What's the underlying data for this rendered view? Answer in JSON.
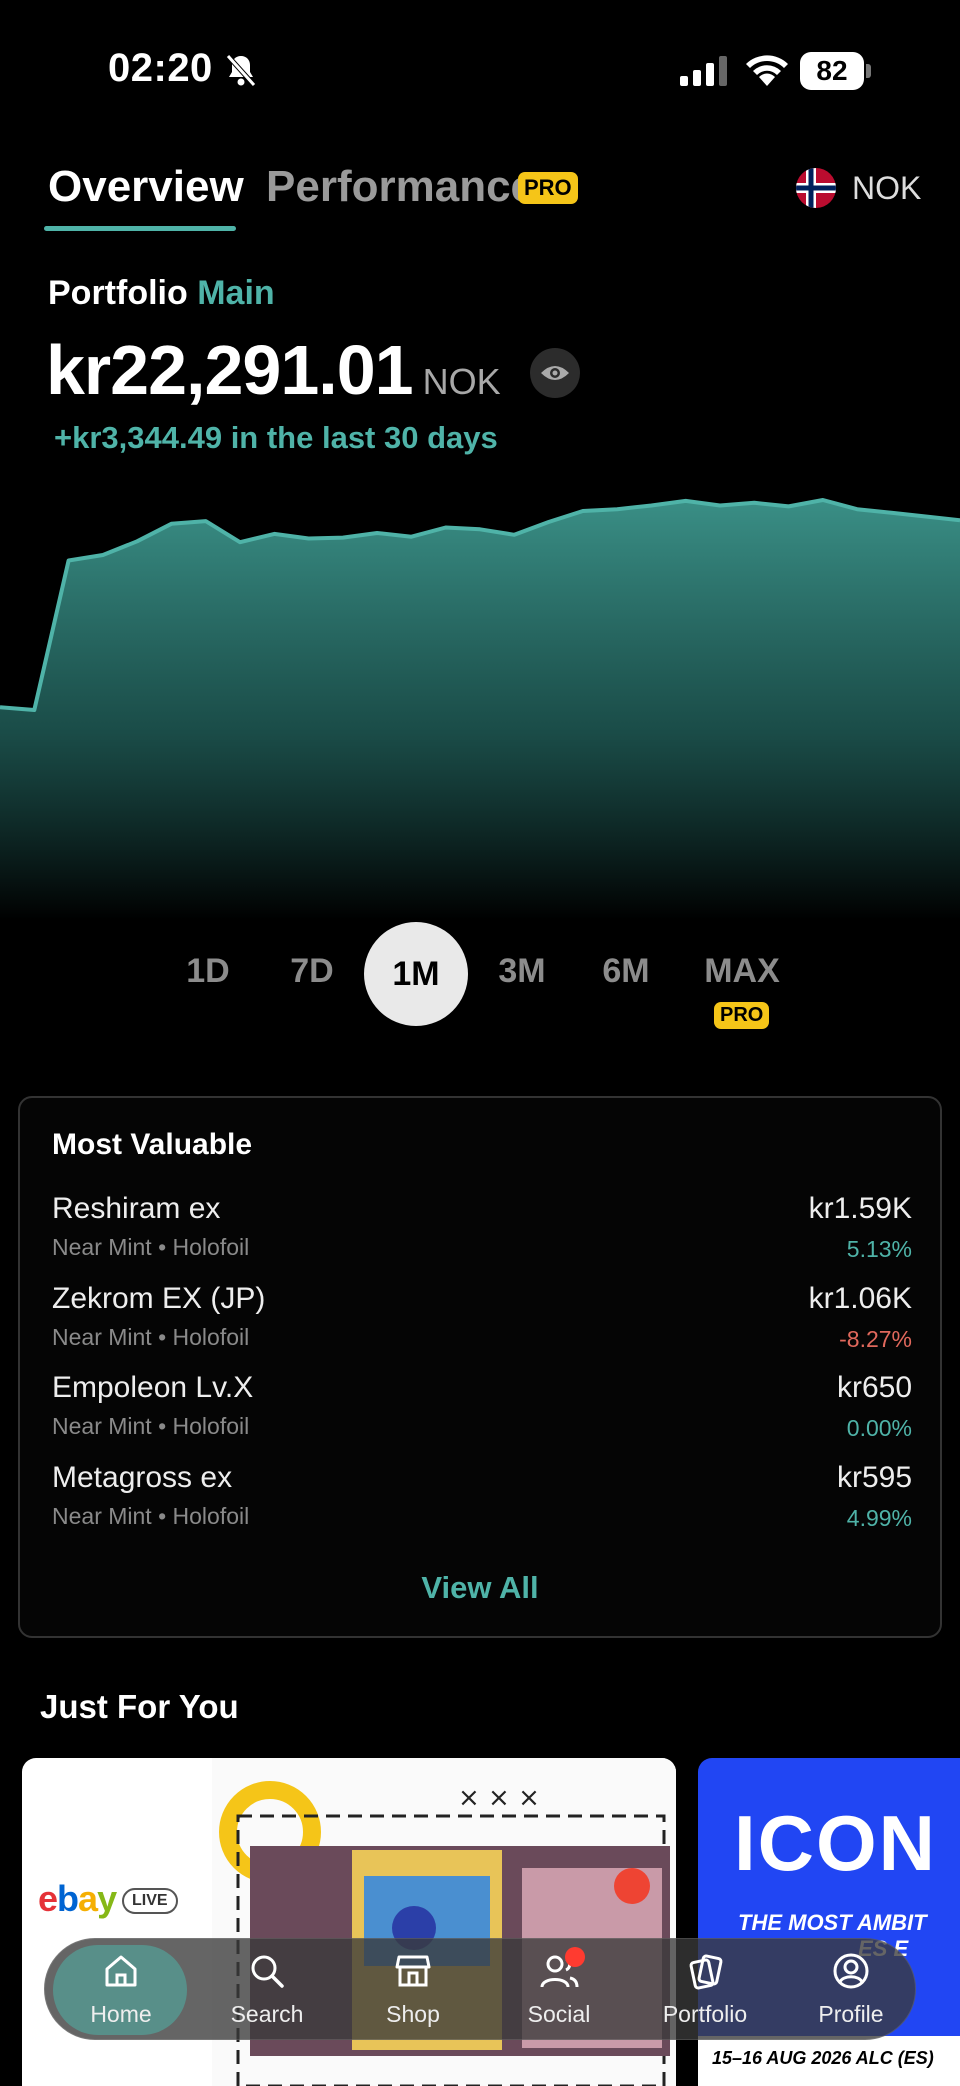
{
  "status_bar": {
    "time": "02:20",
    "battery": "82"
  },
  "tabs": {
    "overview": "Overview",
    "performance": "Performance",
    "pro_badge": "PRO"
  },
  "currency": {
    "code": "NOK",
    "icon": "norway-flag-icon"
  },
  "portfolio": {
    "label": "Portfolio",
    "name": "Main",
    "value": "kr22,291.01",
    "value_currency": "NOK",
    "change": "+kr3,344.49 in the last 30 days"
  },
  "chart_data": {
    "type": "area",
    "title": "",
    "xlabel": "",
    "ylabel": "",
    "color": "#4fb3a8",
    "range": "1M",
    "values": [
      19600,
      19570,
      21200,
      21260,
      21410,
      21600,
      21630,
      21400,
      21490,
      21440,
      21450,
      21500,
      21460,
      21560,
      21540,
      21480,
      21620,
      21740,
      21760,
      21800,
      21850,
      21800,
      21830,
      21790,
      21860,
      21760,
      21720,
      21680,
      21640
    ]
  },
  "ranges": {
    "d1": "1D",
    "d7": "7D",
    "m1": "1M",
    "m3": "3M",
    "m6": "6M",
    "max": "MAX",
    "max_badge": "PRO",
    "selected": "1M"
  },
  "most_valuable": {
    "title": "Most Valuable",
    "items": [
      {
        "name": "Reshiram ex",
        "condition": "Near Mint • Holofoil",
        "price": "kr1.59K",
        "change": "5.13%",
        "trend": "up"
      },
      {
        "name": "Zekrom EX (JP)",
        "condition": "Near Mint • Holofoil",
        "price": "kr1.06K",
        "change": "-8.27%",
        "trend": "down"
      },
      {
        "name": "Empoleon Lv.X",
        "condition": "Near Mint • Holofoil",
        "price": "kr650",
        "change": "0.00%",
        "trend": "flat"
      },
      {
        "name": "Metagross ex",
        "condition": "Near Mint • Holofoil",
        "price": "kr595",
        "change": "4.99%",
        "trend": "up"
      }
    ],
    "view_all": "View All"
  },
  "just_for_you": {
    "title": "Just For You",
    "promo1": {
      "brand": "ebay",
      "live_label": "LIVE"
    },
    "promo2": {
      "logo": "ICON",
      "tagline": "THE MOST AMBIT",
      "tagline2": "ES E",
      "date": "15–16 AUG 2026 ALC (ES)"
    }
  },
  "nav": {
    "home": "Home",
    "search": "Search",
    "shop": "Shop",
    "social": "Social",
    "portfolio": "Portfolio",
    "profile": "Profile",
    "active": "Home"
  },
  "colors": {
    "accent": "#4fb3a8",
    "pro": "#f5c518",
    "negative": "#e0685c",
    "background": "#000000"
  }
}
